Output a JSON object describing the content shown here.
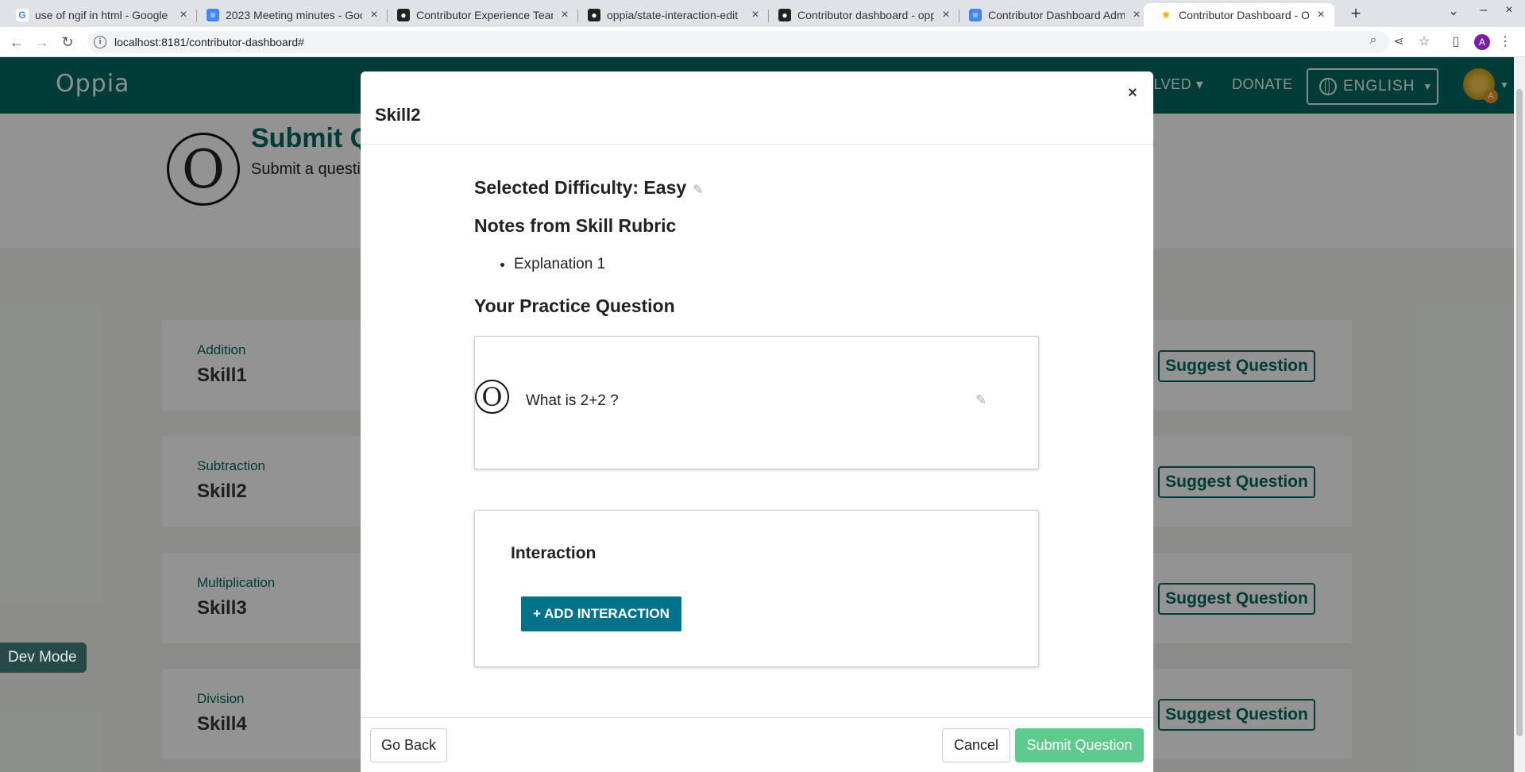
{
  "browser": {
    "tabs": [
      {
        "label": "use of ngif in html - Google Se",
        "icon": "google-icon"
      },
      {
        "label": "2023 Meeting minutes - Googl",
        "icon": "docs-icon"
      },
      {
        "label": "Contributor Experience Team",
        "icon": "github-icon"
      },
      {
        "label": "oppia/state-interaction-edit",
        "icon": "github-icon"
      },
      {
        "label": "Contributor dashboard - opp",
        "icon": "github-icon"
      },
      {
        "label": "Contributor Dashboard Admi",
        "icon": "docs-icon"
      },
      {
        "label": "Contributor Dashboard - Opp",
        "icon": "oppia-icon",
        "active": true
      }
    ],
    "url": "localhost:8181/contributor-dashboard#",
    "profile_initial": "A"
  },
  "topnav": {
    "logo": "Oppia",
    "get_involved": "OLVED",
    "donate": "DONATE",
    "language": "ENGLISH",
    "avatar_badge": "A"
  },
  "header": {
    "title": "Submit Q",
    "subtitle": "Submit a questi"
  },
  "skills": [
    {
      "topic": "Addition",
      "name": "Skill1",
      "action": "Suggest Question"
    },
    {
      "topic": "Subtraction",
      "name": "Skill2",
      "action": "Suggest Question"
    },
    {
      "topic": "Multiplication",
      "name": "Skill3",
      "action": "Suggest Question"
    },
    {
      "topic": "Division",
      "name": "Skill4",
      "action": "Suggest Question"
    }
  ],
  "dev_mode": "Dev Mode",
  "modal": {
    "title": "Skill2",
    "close": "×",
    "difficulty": "Selected Difficulty: Easy",
    "rubric_title": "Notes from Skill Rubric",
    "rubric_notes": [
      "Explanation 1"
    ],
    "practice_title": "Your Practice Question",
    "question_text": "What is 2+2 ?",
    "interaction_title": "Interaction",
    "add_interaction": "+ ADD INTERACTION",
    "go_back": "Go Back",
    "cancel": "Cancel",
    "submit": "Submit Question"
  },
  "colors": {
    "brand": "#00645c",
    "add_interaction_bg": "#00728a",
    "submit_bg": "#5ecb8c"
  }
}
